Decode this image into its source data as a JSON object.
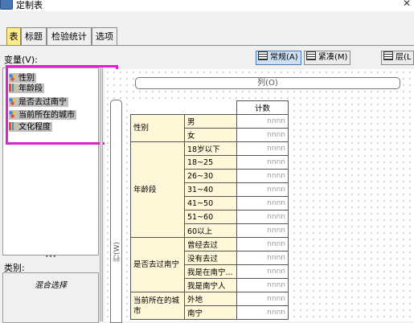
{
  "window": {
    "title": "定制表"
  },
  "tabs": [
    "表",
    "标题",
    "检验统计",
    "选项"
  ],
  "variables": {
    "label": "变量(V):",
    "items": [
      {
        "name": "性别",
        "icon": "nominal-icon"
      },
      {
        "name": "年龄段",
        "icon": "ordinal-icon"
      },
      {
        "name": "是否去过南宁",
        "icon": "nominal-icon"
      },
      {
        "name": "当前所在的城市",
        "icon": "nominal-icon"
      },
      {
        "name": "文化程度",
        "icon": "ordinal-icon"
      }
    ]
  },
  "categories": {
    "label": "类别:",
    "value": "混合选择"
  },
  "toolbar": {
    "normal": "常规(A)",
    "compact": "紧凑(M)",
    "layers": "层(L"
  },
  "column_drop": "列(O)",
  "row_drop": "行(W)",
  "table": {
    "header": "计数",
    "placeholder": "nnnn",
    "groups": [
      {
        "variable": "性别",
        "categories": [
          "男",
          "女"
        ]
      },
      {
        "variable": "年龄段",
        "categories": [
          "18岁以下",
          "18~25",
          "26~30",
          "31~40",
          "41~50",
          "51~60",
          "60以上"
        ]
      },
      {
        "variable": "是否去过南宁",
        "categories": [
          "曾经去过",
          "没有去过",
          "我是在南宁...",
          "我是南宁人"
        ]
      },
      {
        "variable": "当前所在的城市",
        "categories": [
          "外地",
          "南宁"
        ]
      }
    ]
  }
}
